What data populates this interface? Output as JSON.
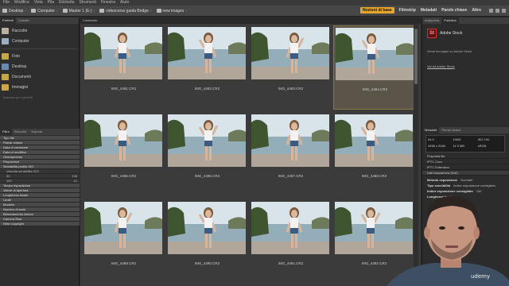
{
  "menubar": [
    "File",
    "Modifica",
    "Vista",
    "Pila",
    "Etichetta",
    "Strumenti",
    "Finestra",
    "Aiuto"
  ],
  "path": [
    {
      "label": "Desktop"
    },
    {
      "label": "Computer"
    },
    {
      "label": "Master 1 (E:)"
    },
    {
      "label": "videocorso guida Bridge"
    },
    {
      "label": "new images"
    }
  ],
  "workspaces": {
    "active": "Nozioni di base",
    "items": [
      "Filmstrip",
      "Metadati",
      "Parole chiave",
      "Altro"
    ]
  },
  "left": {
    "tabs": [
      "Preferiti",
      "Cartelle"
    ],
    "favorites": [
      {
        "label": "Raccolte",
        "color": "#b8b0a0"
      },
      {
        "label": "Computer",
        "color": "#9ab0c0"
      },
      {
        "label": "Foto",
        "color": "#c7a54a"
      },
      {
        "label": "Desktop",
        "color": "#6a8ab0"
      },
      {
        "label": "Documenti",
        "color": "#c7a54a"
      },
      {
        "label": "Immagini",
        "color": "#c7a54a"
      }
    ],
    "favorites_trailing": "Trascina qui i preferiti",
    "filter_tabs": [
      "Filtro",
      "Raccolte",
      "Esporta"
    ],
    "filters": [
      {
        "label": "Tipo file",
        "kind": "head",
        "count": ""
      },
      {
        "label": "Parole chiave",
        "kind": "head",
        "count": ""
      },
      {
        "label": "Data di creazione",
        "kind": "head",
        "count": ""
      },
      {
        "label": "Data di modifica",
        "kind": "head",
        "count": ""
      },
      {
        "label": "Orientamento",
        "kind": "head",
        "count": ""
      },
      {
        "label": "Proporzioni",
        "kind": "head",
        "count": ""
      },
      {
        "label": "Sensibilità profilo ISO",
        "kind": "head",
        "count": ""
      },
      {
        "label": "Velocità sensibilità ISO",
        "kind": "sub",
        "count": ""
      },
      {
        "label": "50",
        "kind": "sub",
        "count": "198"
      },
      {
        "label": "100",
        "kind": "sub",
        "count": "12"
      },
      {
        "label": "Tempo esposizione",
        "kind": "head",
        "count": ""
      },
      {
        "label": "Valore di apertura",
        "kind": "head",
        "count": ""
      },
      {
        "label": "Lunghezza focale",
        "kind": "head",
        "count": ""
      },
      {
        "label": "Lente",
        "kind": "head",
        "count": ""
      },
      {
        "label": "Modello",
        "kind": "head",
        "count": ""
      },
      {
        "label": "Numero di serie",
        "kind": "head",
        "count": ""
      },
      {
        "label": "Bilanciamento bianco",
        "kind": "head",
        "count": ""
      },
      {
        "label": "Camera Raw",
        "kind": "head",
        "count": ""
      },
      {
        "label": "Note copyright",
        "kind": "head",
        "count": ""
      }
    ]
  },
  "content": {
    "tab": "Contenuto",
    "images": [
      {
        "name": "IMG_4481.CR2",
        "selected": false,
        "pose": 1
      },
      {
        "name": "IMG_4482.CR2",
        "selected": false,
        "pose": 2
      },
      {
        "name": "IMG_4483.CR2",
        "selected": false,
        "pose": 3
      },
      {
        "name": "IMG_4484.CR2",
        "selected": true,
        "pose": 4
      },
      {
        "name": "IMG_4485.CR2",
        "selected": false,
        "pose": 5
      },
      {
        "name": "IMG_4486.CR2",
        "selected": false,
        "pose": 6
      },
      {
        "name": "IMG_4487.CR2",
        "selected": false,
        "pose": 7
      },
      {
        "name": "IMG_4488.CR2",
        "selected": false,
        "pose": 8
      },
      {
        "name": "IMG_4489.CR2",
        "selected": false,
        "pose": 9
      },
      {
        "name": "IMG_4490.CR2",
        "selected": false,
        "pose": 10
      },
      {
        "name": "IMG_4491.CR2",
        "selected": false,
        "pose": 11
      },
      {
        "name": "IMG_4492.CR2",
        "selected": false,
        "pose": 12
      }
    ]
  },
  "right": {
    "tabs": [
      "Anteprima",
      "Pubblica"
    ],
    "stock": {
      "logo": "St",
      "title": "Adobe Stock",
      "text": "Vendi immagini su Adobe Stock",
      "link": "Vai ad Adobe Stock"
    },
    "meta_tabs": [
      "Metadati",
      "Parole chiave"
    ],
    "camera": [
      "f/4.0",
      "1/500",
      "ISO 100",
      "3456 x 5184",
      "11.9 MB",
      "sRGB"
    ],
    "sections": [
      "Proprietà file",
      "IPTC Core",
      "IPTC Extension",
      "Dati fotocamera (Exif)"
    ],
    "rows": [
      {
        "k": "Metodo esposizione",
        "v": "Normale"
      },
      {
        "k": "Tipo sensibilità",
        "v": "Indice esposizione consigliato"
      },
      {
        "k": "Indice esposizione consigliato",
        "v": "100"
      },
      {
        "k": "Lunghezza focale",
        "v": ""
      }
    ]
  },
  "overlay": {
    "brand": "udemy"
  }
}
